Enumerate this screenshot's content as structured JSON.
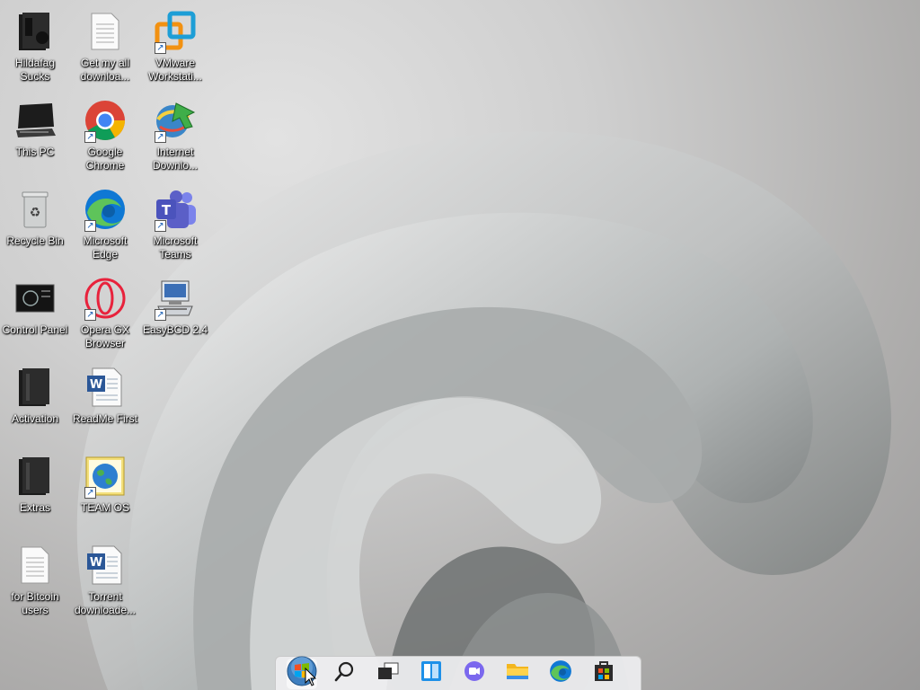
{
  "desktop": {
    "icons": [
      {
        "id": "hildafag",
        "label": "Hildafag\nSucks",
        "icon": "black-folder-icon",
        "shortcut": false
      },
      {
        "id": "this-pc",
        "label": "This PC",
        "icon": "monitor-icon",
        "shortcut": false
      },
      {
        "id": "recycle-bin",
        "label": "Recycle Bin",
        "icon": "recycle-bin-icon",
        "shortcut": false
      },
      {
        "id": "control-panel",
        "label": "Control Panel",
        "icon": "control-panel-icon",
        "shortcut": false
      },
      {
        "id": "activation",
        "label": "Activation",
        "icon": "black-folder-icon",
        "shortcut": false
      },
      {
        "id": "extras",
        "label": "Extras",
        "icon": "black-folder-icon",
        "shortcut": false
      },
      {
        "id": "for-bitcoin",
        "label": "for Bitcoin\nusers",
        "icon": "text-document-icon",
        "shortcut": false
      },
      {
        "id": "get-my-all",
        "label": "Get my all\ndownloa...",
        "icon": "text-document-icon",
        "shortcut": false
      },
      {
        "id": "chrome",
        "label": "Google\nChrome",
        "icon": "chrome-icon",
        "shortcut": true
      },
      {
        "id": "edge",
        "label": "Microsoft\nEdge",
        "icon": "edge-icon",
        "shortcut": true
      },
      {
        "id": "opera",
        "label": "Opera GX\nBrowser",
        "icon": "opera-gx-icon",
        "shortcut": true
      },
      {
        "id": "readme",
        "label": "ReadMe First",
        "icon": "word-document-icon",
        "shortcut": false
      },
      {
        "id": "team-os",
        "label": "TEAM OS",
        "icon": "internet-shortcut-icon",
        "shortcut": true
      },
      {
        "id": "torrent",
        "label": "Torrent\ndownloade...",
        "icon": "word-document-icon",
        "shortcut": false
      },
      {
        "id": "vmware",
        "label": "VMware\nWorkstati...",
        "icon": "vmware-icon",
        "shortcut": true
      },
      {
        "id": "idm",
        "label": "Internet\nDownlo...",
        "icon": "internet-download-manager-icon",
        "shortcut": true
      },
      {
        "id": "teams",
        "label": "Microsoft\nTeams",
        "icon": "teams-icon",
        "shortcut": true
      },
      {
        "id": "easybcd",
        "label": "EasyBCD 2.4",
        "icon": "easybcd-icon",
        "shortcut": true
      }
    ]
  },
  "taskbar": {
    "buttons": [
      {
        "id": "start",
        "icon": "windows-7-start-orb-icon"
      },
      {
        "id": "search",
        "icon": "search-icon"
      },
      {
        "id": "task-view",
        "icon": "task-view-icon"
      },
      {
        "id": "widgets",
        "icon": "widgets-icon"
      },
      {
        "id": "chat",
        "icon": "teams-chat-icon"
      },
      {
        "id": "file-explorer",
        "icon": "folder-icon"
      },
      {
        "id": "edge",
        "icon": "edge-icon"
      },
      {
        "id": "store",
        "icon": "store-icon"
      }
    ]
  },
  "colors": {
    "label_text": "#ffffff",
    "taskbar_bg": "#eeeef0",
    "edge_blue": "#0f78d4",
    "edge_green": "#5ec45a",
    "chrome_red": "#db4437",
    "chrome_yellow": "#f4b400",
    "chrome_green": "#0f9d58",
    "teams_purple": "#5b5fc7",
    "opera_red": "#e8223c",
    "vmware_orange": "#f29111",
    "vmware_blue": "#1d9ed6"
  }
}
